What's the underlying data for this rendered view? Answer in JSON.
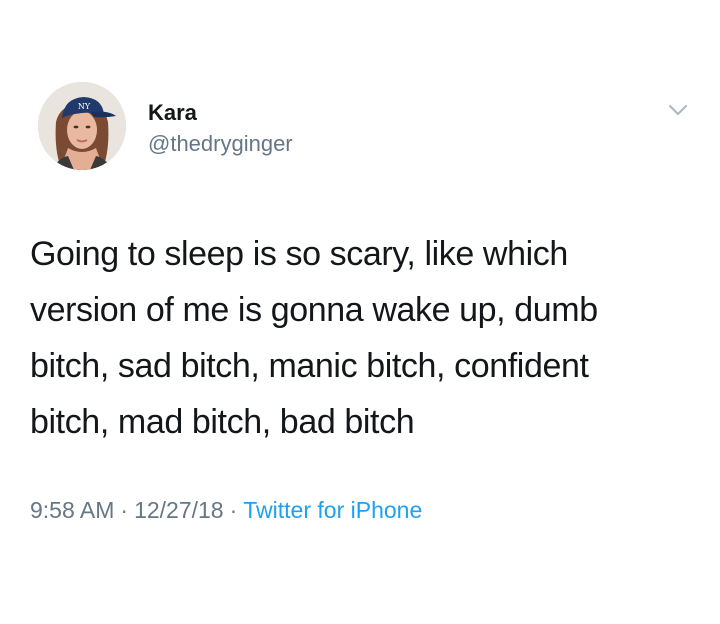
{
  "author": {
    "display_name": "Kara",
    "handle": "@thedryginger",
    "avatar_icon": "profile-photo-avatar"
  },
  "tweet": {
    "text_lines": [
      "Going to sleep is so scary, like which",
      "version of me is gonna wake up, dumb",
      "bitch, sad bitch, manic bitch, confident",
      "bitch, mad bitch, bad bitch"
    ]
  },
  "meta": {
    "time": "9:58 AM",
    "date": "12/27/18",
    "separator": "·",
    "source": "Twitter for iPhone"
  },
  "icons": {
    "menu": "chevron-down-icon"
  },
  "colors": {
    "text": "#14171a",
    "secondary": "#657786",
    "link": "#1da1f2",
    "background": "#ffffff"
  }
}
